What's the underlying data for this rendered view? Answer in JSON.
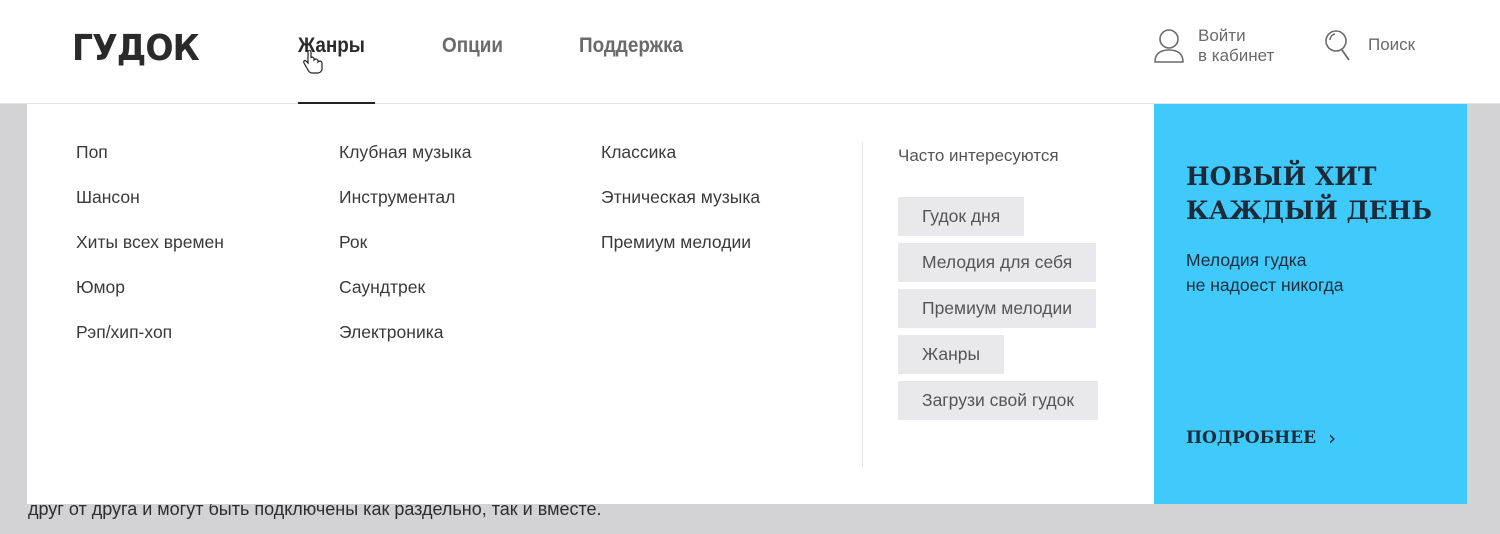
{
  "header": {
    "logo": "ГУДОК",
    "nav": [
      {
        "label": "Жанры",
        "active": true
      },
      {
        "label": "Опции",
        "active": false
      },
      {
        "label": "Поддержка",
        "active": false
      }
    ],
    "login": {
      "icon": "user-icon",
      "line1": "Войти",
      "line2": "в кабинет"
    },
    "search": {
      "icon": "search-icon",
      "label": "Поиск"
    }
  },
  "dropdown": {
    "columns": [
      [
        "Поп",
        "Шансон",
        "Хиты всех времен",
        "Юмор",
        "Рэп/хип-хоп"
      ],
      [
        "Клубная музыка",
        "Инструментал",
        "Рок",
        "Саундтрек",
        "Электроника"
      ],
      [
        "Классика",
        "Этническая музыка",
        "Премиум мелодии"
      ]
    ],
    "popular": {
      "title": "Часто интересуются",
      "tags": [
        "Гудок дня",
        "Мелодия для себя",
        "Премиум мелодии",
        "Жанры",
        "Загрузи свой гудок"
      ]
    }
  },
  "promo": {
    "title": "НОВЫЙ ХИТ\nКАЖДЫЙ ДЕНЬ",
    "subtitle": "Мелодия гудка\nне надоест никогда",
    "more": "ПОДРОБНЕЕ",
    "more_icon": "chevron-right-icon",
    "bg_color": "#40c9fb"
  },
  "background": {
    "text": "друг от друга и могут быть подключены как раздельно, так и вместе."
  }
}
